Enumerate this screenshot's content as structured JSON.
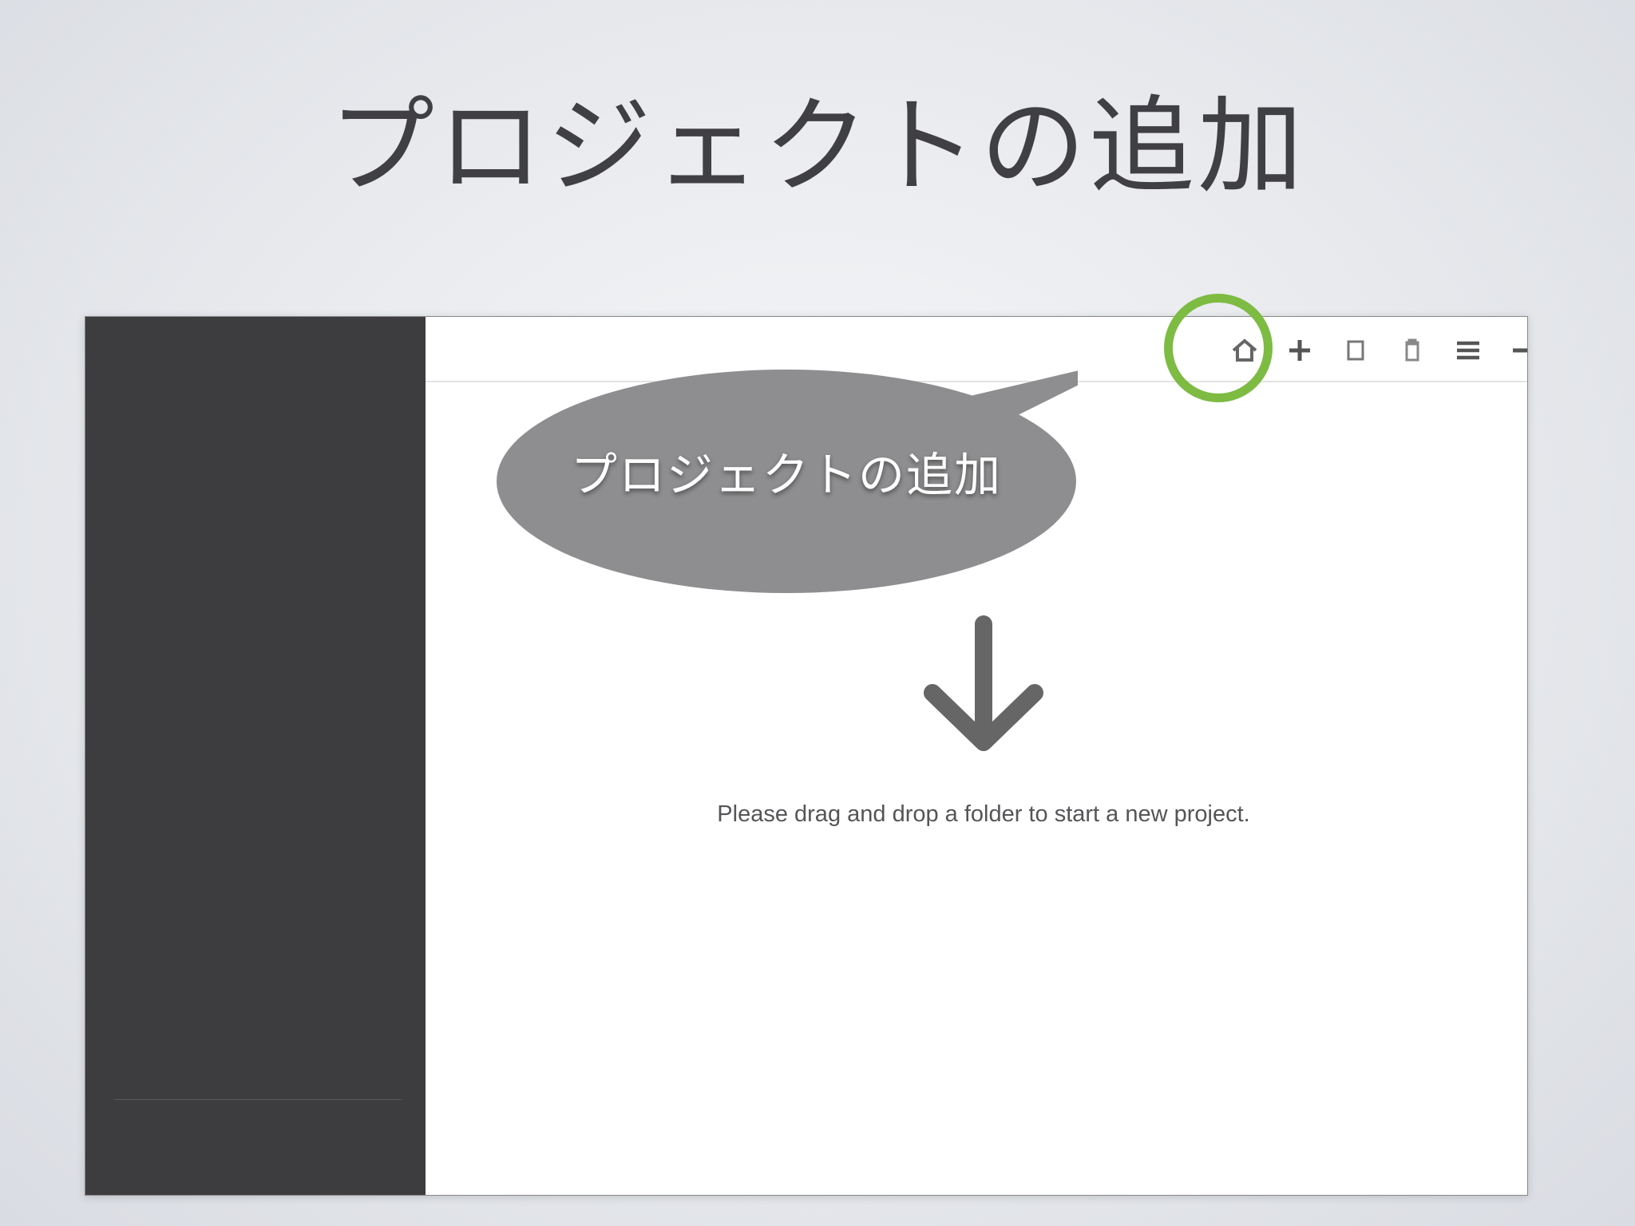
{
  "slide": {
    "title": "プロジェクトの追加"
  },
  "callout": {
    "label": "プロジェクトの追加"
  },
  "toolbar": {
    "icons": [
      "home-icon",
      "add-project-icon",
      "window-icon",
      "clipboard-icon",
      "menu-icon",
      "minimize-icon",
      "close-icon"
    ]
  },
  "main": {
    "drop_message": "Please drag and drop a folder to start a new project."
  },
  "colors": {
    "highlight": "#7dbb43",
    "sidebar": "#3d3c3f",
    "callout": "#8e8e90"
  }
}
